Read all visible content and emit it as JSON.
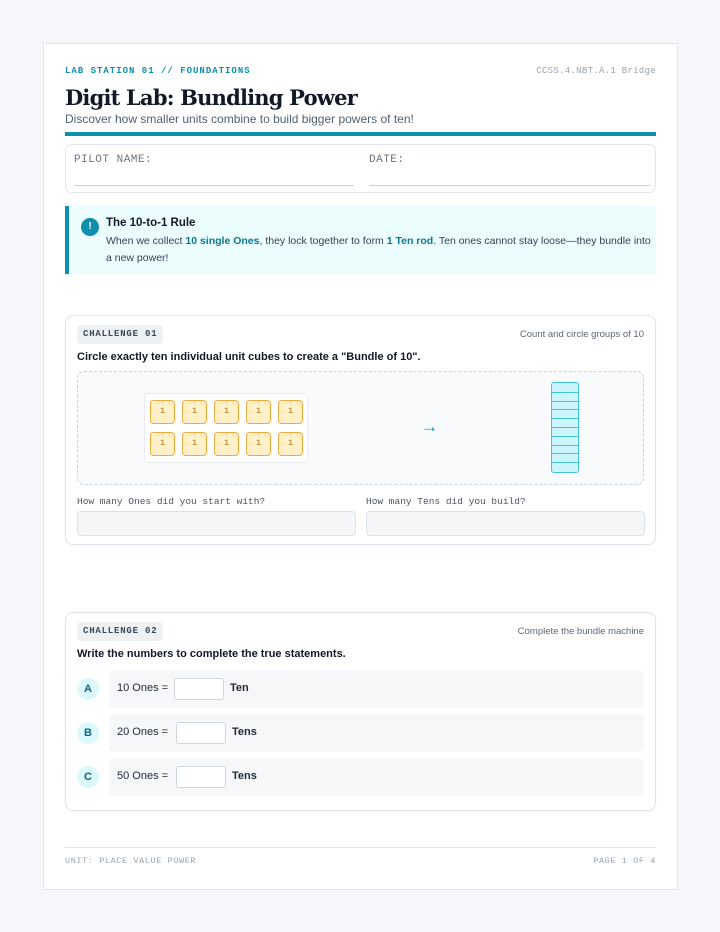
{
  "header": {
    "station": "LAB STATION 01 // FOUNDATIONS",
    "standard": "CCSS.4.NBT.A.1 Bridge",
    "title": "Digit Lab: Bundling Power",
    "subtitle": "Discover how smaller units combine to build bigger powers of ten!"
  },
  "pilot": {
    "name_label": "PILOT NAME:",
    "date_label": "DATE:"
  },
  "rule": {
    "icon": "exclamation-icon",
    "icon_text": "!",
    "title": "The 10-to-1 Rule",
    "text_1": "When we collect ",
    "highlight_1": "10 single Ones",
    "text_2": ", they lock together to form ",
    "highlight_2": "1 Ten rod",
    "text_3": ". Ten ones cannot stay loose—they bundle into a new power!"
  },
  "challenge1": {
    "badge": "CHALLENGE 01",
    "hint": "Count and circle groups of 10",
    "question": "Circle exactly ten individual unit cubes to create a \"Bundle of 10\".",
    "cubes": [
      "1",
      "1",
      "1",
      "1",
      "1",
      "1",
      "1",
      "1",
      "1",
      "1"
    ],
    "arrow": "→",
    "rod_segments": 10,
    "ones_label": "How many Ones did you start with?",
    "tens_label": "How many Tens did you build?"
  },
  "challenge2": {
    "badge": "CHALLENGE 02",
    "hint": "Complete the bundle machine",
    "question": "Write the numbers to complete the true statements.",
    "rows": [
      {
        "letter": "A",
        "text": "10 Ones =",
        "unit": "Ten"
      },
      {
        "letter": "B",
        "text": "20 Ones =",
        "unit": "Tens"
      },
      {
        "letter": "C",
        "text": "50 Ones =",
        "unit": "Tens"
      }
    ]
  },
  "footer": {
    "unit": "UNIT: PLACE VALUE POWER",
    "page": "PAGE 1 OF 4"
  },
  "colors": {
    "accent": "#0e8fae",
    "cube_fill": "#fff0c7",
    "cube_border": "#f0a93b",
    "rod_fill": "#ccf5fb",
    "rod_border": "#45c5d9"
  }
}
